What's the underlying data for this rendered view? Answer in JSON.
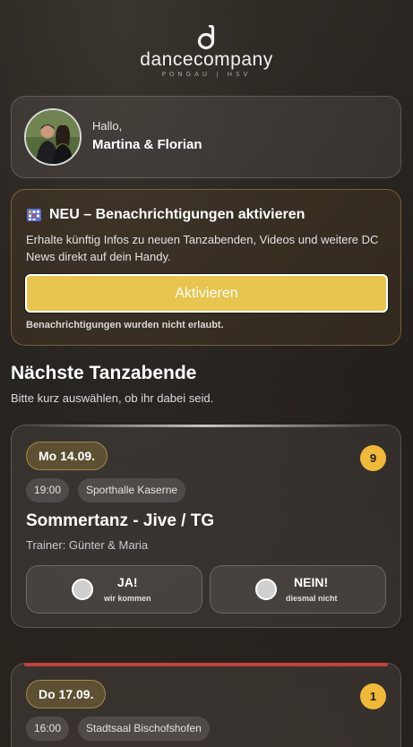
{
  "logo": {
    "name_left": "dance",
    "name_right": "company",
    "subtitle": "PONGAU | HSV"
  },
  "greeting": {
    "hello": "Hallo,",
    "names": "Martina & Florian"
  },
  "notification": {
    "title": "NEU – Benachrichtigungen aktivieren",
    "text": "Erhalte künftig Infos zu neuen Tanzabenden, Videos und weitere DC News direkt auf dein Handy.",
    "button_label": "Aktivieren",
    "status": "Benachrichtigungen wurden nicht erlaubt.",
    "icon": "bell-grid-icon"
  },
  "section": {
    "title": "Nächste Tanzabende",
    "subtitle": "Bitte kurz auswählen, ob ihr dabei seid."
  },
  "events": [
    {
      "date": "Mo 14.09.",
      "count": "9",
      "time": "19:00",
      "location": "Sporthalle Kaserne",
      "title": "Sommertanz - Jive / TG",
      "trainer": "Trainer: Günter & Maria",
      "yes_label": "JA!",
      "yes_sub": "wir kommen",
      "no_label": "NEIN!",
      "no_sub": "diesmal nicht",
      "accent": "#e6e6e6"
    },
    {
      "date": "Do 17.09.",
      "count": "1",
      "time": "16:00",
      "location": "Stadtsaal Bischofshofen",
      "accent": "#c0433e"
    }
  ],
  "colors": {
    "accent_yellow": "#e8c54f",
    "badge": "#f0b93a",
    "date_pill": "#8c7337"
  }
}
